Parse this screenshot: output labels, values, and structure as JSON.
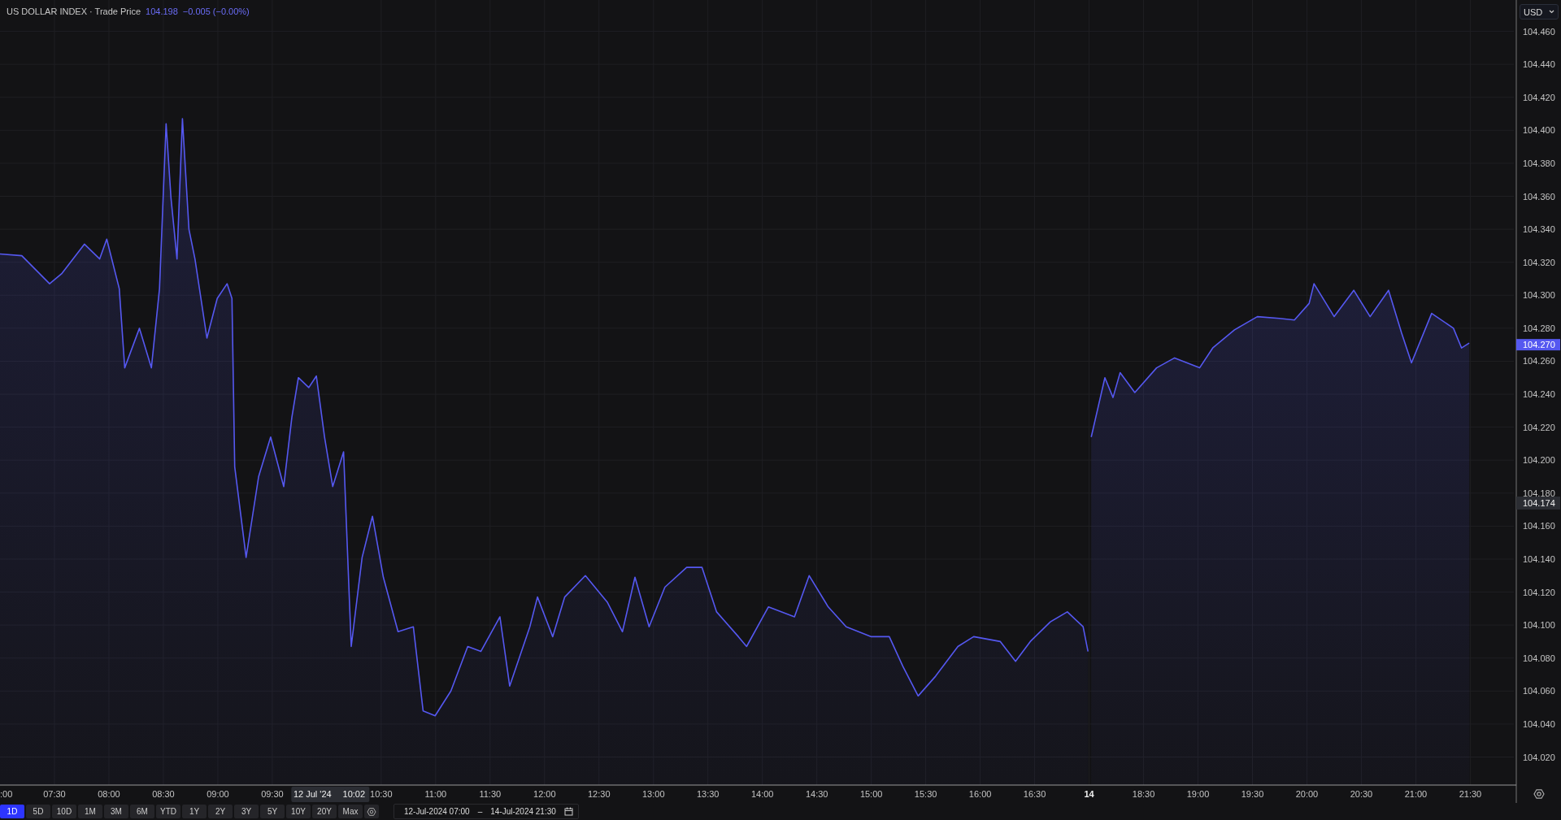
{
  "header": {
    "title": "US DOLLAR INDEX · Trade Price",
    "price": "104.198",
    "change": "−0.005 (−0.00%)"
  },
  "currency": "USD",
  "chart": {
    "edge_label": ":00",
    "day_label": "14",
    "last_price_tag": "104.270",
    "crosshair": {
      "date": "12 Jul '24",
      "time": "10:02",
      "price": "104.174"
    },
    "sessions": [
      {
        "chart_data": {
          "type": "area",
          "grid": true,
          "x": [
            7,
            7.2,
            7.455,
            7.565,
            7.775,
            7.915,
            7.98,
            8.095,
            8.145,
            8.28,
            8.39,
            8.465,
            8.525,
            8.57,
            8.625,
            8.675,
            8.735,
            8.79,
            8.9,
            8.995,
            9.085,
            9.13,
            9.155,
            9.26,
            9.375,
            9.485,
            9.605,
            9.68,
            9.74,
            9.835,
            9.905,
            9.98,
            10.055,
            10.155,
            10.225,
            10.325,
            10.42,
            10.52,
            10.655,
            10.795,
            10.885,
            10.995,
            11.14,
            11.295,
            11.415,
            11.59,
            11.68,
            11.865,
            11.935,
            12.075,
            12.185,
            12.375,
            12.575,
            12.715,
            12.83,
            12.96,
            13.105,
            13.305,
            13.445,
            13.58,
            13.78,
            13.855,
            14.055,
            14.295,
            14.43,
            14.605,
            14.77,
            15.0,
            15.165,
            15.29,
            15.43,
            15.59,
            15.795,
            15.94,
            16.185,
            16.325,
            16.46,
            16.645,
            16.8,
            16.945,
            16.99
          ],
          "series": [
            {
              "color": "#5558f0",
              "values": [
                104.325,
                104.324,
                104.307,
                104.313,
                104.331,
                104.322,
                104.334,
                104.304,
                104.256,
                104.28,
                104.256,
                104.304,
                104.404,
                104.359,
                104.322,
                104.407,
                104.34,
                104.322,
                104.274,
                104.298,
                104.307,
                104.298,
                104.196,
                104.141,
                104.19,
                104.214,
                104.184,
                104.226,
                104.25,
                104.244,
                104.251,
                104.214,
                104.184,
                104.205,
                104.087,
                104.141,
                104.166,
                104.129,
                104.096,
                104.099,
                104.048,
                104.045,
                104.06,
                104.087,
                104.084,
                104.105,
                104.063,
                104.099,
                104.117,
                104.093,
                104.117,
                104.13,
                104.114,
                104.096,
                104.129,
                104.099,
                104.123,
                104.135,
                104.135,
                104.108,
                104.093,
                104.087,
                104.111,
                104.105,
                104.13,
                104.111,
                104.099,
                104.093,
                104.093,
                104.075,
                104.057,
                104.069,
                104.087,
                104.093,
                104.09,
                104.078,
                104.09,
                104.102,
                104.108,
                104.099,
                104.084
              ]
            }
          ],
          "xlim": [
            7,
            17
          ],
          "ylim": [
            104.003,
            104.479
          ],
          "xticks": [
            {
              "value": 7.5,
              "label": "07:30"
            },
            {
              "value": 8,
              "label": "08:00"
            },
            {
              "value": 8.5,
              "label": "08:30"
            },
            {
              "value": 9,
              "label": "09:00"
            },
            {
              "value": 9.5,
              "label": "09:30"
            },
            {
              "value": 10.5,
              "label": "10:30"
            },
            {
              "value": 11,
              "label": "11:00"
            },
            {
              "value": 11.5,
              "label": "11:30"
            },
            {
              "value": 12,
              "label": "12:00"
            },
            {
              "value": 12.5,
              "label": "12:30"
            },
            {
              "value": 13,
              "label": "13:00"
            },
            {
              "value": 13.5,
              "label": "13:30"
            },
            {
              "value": 14,
              "label": "14:00"
            },
            {
              "value": 14.5,
              "label": "14:30"
            },
            {
              "value": 15,
              "label": "15:00"
            },
            {
              "value": 15.5,
              "label": "15:30"
            },
            {
              "value": 16,
              "label": "16:00"
            },
            {
              "value": 16.5,
              "label": "16:30"
            }
          ]
        }
      },
      {
        "chart_data": {
          "type": "area",
          "grid": true,
          "x": [
            18.02,
            18.145,
            18.22,
            18.285,
            18.42,
            18.62,
            18.785,
            19.015,
            19.135,
            19.335,
            19.545,
            19.745,
            19.885,
            20.02,
            20.065,
            20.25,
            20.43,
            20.58,
            20.75,
            20.87,
            20.96,
            21.145,
            21.345,
            21.42,
            21.49
          ],
          "series": [
            {
              "color": "#5558f0",
              "values": [
                104.214,
                104.25,
                104.238,
                104.253,
                104.241,
                104.256,
                104.262,
                104.256,
                104.268,
                104.279,
                104.287,
                104.286,
                104.285,
                104.295,
                104.307,
                104.287,
                104.303,
                104.287,
                104.303,
                104.277,
                104.259,
                104.289,
                104.28,
                104.268,
                104.271
              ]
            }
          ],
          "xlim": [
            18,
            21.9
          ],
          "ylim": [
            104.003,
            104.479
          ],
          "xticks": [
            {
              "value": 18.5,
              "label": "18:30"
            },
            {
              "value": 19,
              "label": "19:00"
            },
            {
              "value": 19.5,
              "label": "19:30"
            },
            {
              "value": 20,
              "label": "20:00"
            },
            {
              "value": 20.5,
              "label": "20:30"
            },
            {
              "value": 21,
              "label": "21:00"
            },
            {
              "value": 21.5,
              "label": "21:30"
            }
          ],
          "yticks": [
            {
              "value": 104.02,
              "label": "104.020"
            },
            {
              "value": 104.04,
              "label": "104.040"
            },
            {
              "value": 104.06,
              "label": "104.060"
            },
            {
              "value": 104.08,
              "label": "104.080"
            },
            {
              "value": 104.1,
              "label": "104.100"
            },
            {
              "value": 104.12,
              "label": "104.120"
            },
            {
              "value": 104.14,
              "label": "104.140"
            },
            {
              "value": 104.16,
              "label": "104.160"
            },
            {
              "value": 104.18,
              "label": "104.180"
            },
            {
              "value": 104.2,
              "label": "104.200"
            },
            {
              "value": 104.22,
              "label": "104.220"
            },
            {
              "value": 104.24,
              "label": "104.240"
            },
            {
              "value": 104.26,
              "label": "104.260"
            },
            {
              "value": 104.28,
              "label": "104.280"
            },
            {
              "value": 104.3,
              "label": "104.300"
            },
            {
              "value": 104.32,
              "label": "104.320"
            },
            {
              "value": 104.34,
              "label": "104.340"
            },
            {
              "value": 104.36,
              "label": "104.360"
            },
            {
              "value": 104.38,
              "label": "104.380"
            },
            {
              "value": 104.4,
              "label": "104.400"
            },
            {
              "value": 104.42,
              "label": "104.420"
            },
            {
              "value": 104.44,
              "label": "104.440"
            },
            {
              "value": 104.46,
              "label": "104.460"
            }
          ]
        }
      }
    ]
  },
  "toolbar": {
    "ranges": [
      {
        "label": "1D",
        "selected": true
      },
      {
        "label": "5D",
        "selected": false
      },
      {
        "label": "10D",
        "selected": false
      },
      {
        "label": "1M",
        "selected": false
      },
      {
        "label": "3M",
        "selected": false
      },
      {
        "label": "6M",
        "selected": false
      },
      {
        "label": "YTD",
        "selected": false
      },
      {
        "label": "1Y",
        "selected": false
      },
      {
        "label": "2Y",
        "selected": false
      },
      {
        "label": "3Y",
        "selected": false
      },
      {
        "label": "5Y",
        "selected": false
      },
      {
        "label": "10Y",
        "selected": false
      },
      {
        "label": "20Y",
        "selected": false
      },
      {
        "label": "Max",
        "selected": false
      }
    ],
    "date_range": {
      "start": "12-Jul-2024 07:00",
      "separator": "–",
      "end": "14-Jul-2024 21:30"
    }
  }
}
